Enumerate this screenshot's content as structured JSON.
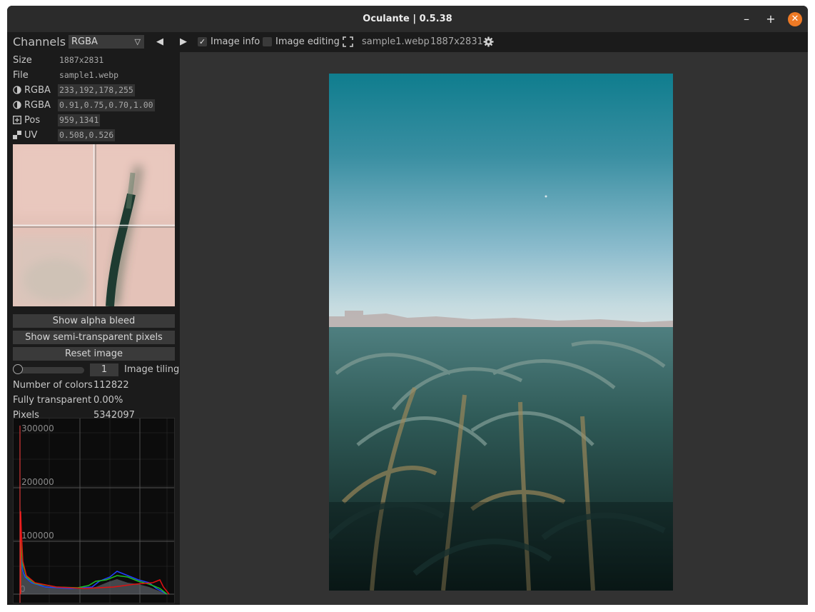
{
  "window": {
    "title": "Oculante | 0.5.38",
    "minimize_glyph": "–",
    "maximize_glyph": "+",
    "close_glyph": "✕"
  },
  "toolbar": {
    "channels_label": "Channels",
    "channel_value": "RGBA",
    "prev_glyph": "◀",
    "next_glyph": "▶",
    "image_info_label": "Image info",
    "image_info_checked": true,
    "image_editing_label": "Image editing",
    "image_editing_checked": false,
    "fullscreen_icon": "fullscreen-icon",
    "filename": "sample1.webp",
    "dimensions": "1887x2831",
    "settings_icon": "gear-icon"
  },
  "info": {
    "size_label": "Size",
    "size_value": "1887x2831",
    "file_label": "File",
    "file_value": "sample1.webp",
    "rgba_label": "RGBA",
    "rgba_value": "233,192,178,255",
    "rgba_float_label": "RGBA",
    "rgba_float_value": "0.91,0.75,0.70,1.00",
    "pos_label": "Pos",
    "pos_value": "959,1341",
    "uv_label": "UV",
    "uv_value": "0.508,0.526"
  },
  "actions": {
    "show_alpha_bleed": "Show alpha bleed",
    "show_semi_transparent": "Show semi-transparent pixels",
    "reset_image": "Reset image"
  },
  "tiling": {
    "value": "1",
    "label": "Image tiling"
  },
  "stats": {
    "colors_label": "Number of colors",
    "colors_value": "112822",
    "transparent_label": "Fully transparent",
    "transparent_value": "0.00%",
    "pixels_label": "Pixels",
    "pixels_value": "5342097"
  },
  "histogram": {
    "y_ticks": [
      "300000",
      "200000",
      "100000",
      "0"
    ],
    "colors": {
      "red": "#e01010",
      "green": "#20c020",
      "blue": "#2040ff",
      "gray": "#a0a0a0"
    }
  },
  "colors": {
    "accent": "#ee7a25",
    "panel": "#1b1b1b",
    "viewer": "#323232"
  }
}
